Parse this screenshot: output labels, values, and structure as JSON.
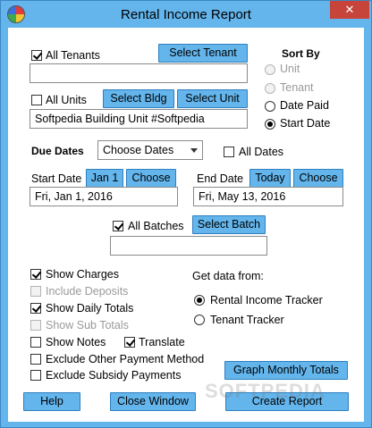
{
  "window": {
    "title": "Rental Income Report",
    "close_glyph": "✕"
  },
  "tenants": {
    "all_tenants_label": "All Tenants",
    "all_tenants_checked": true,
    "select_tenant_button": "Select Tenant",
    "tenant_value": ""
  },
  "units": {
    "all_units_label": "All Units",
    "all_units_checked": false,
    "select_bldg_button": "Select Bldg",
    "select_unit_button": "Select Unit",
    "unit_value": "Softpedia Building Unit #Softpedia"
  },
  "sort_by": {
    "heading": "Sort By",
    "options": [
      {
        "label": "Unit",
        "checked": false,
        "enabled": false
      },
      {
        "label": "Tenant",
        "checked": false,
        "enabled": false
      },
      {
        "label": "Date Paid",
        "checked": false,
        "enabled": true
      },
      {
        "label": "Start Date",
        "checked": true,
        "enabled": true
      }
    ]
  },
  "due_dates": {
    "heading": "Due Dates",
    "selected": "Choose Dates",
    "all_dates_label": "All Dates",
    "all_dates_checked": false
  },
  "start_date": {
    "label": "Start Date",
    "quick_button": "Jan 1",
    "choose_button": "Choose",
    "value": "Fri, Jan 1, 2016"
  },
  "end_date": {
    "label": "End Date",
    "quick_button": "Today",
    "choose_button": "Choose",
    "value": "Fri, May 13, 2016"
  },
  "batches": {
    "all_batches_label": "All Batches",
    "all_batches_checked": true,
    "select_batch_button": "Select Batch",
    "batch_value": ""
  },
  "options": [
    {
      "label": "Show Charges",
      "checked": true,
      "enabled": true
    },
    {
      "label": "Include Deposits",
      "checked": false,
      "enabled": false
    },
    {
      "label": "Show Daily Totals",
      "checked": true,
      "enabled": true
    },
    {
      "label": "Show Sub Totals",
      "checked": false,
      "enabled": false
    },
    {
      "label": "Show Notes",
      "checked": false,
      "enabled": true
    },
    {
      "label": "Translate",
      "checked": true,
      "enabled": true
    },
    {
      "label": "Exclude Other Payment Method",
      "checked": false,
      "enabled": true
    },
    {
      "label": "Exclude Subsidy Payments",
      "checked": false,
      "enabled": true
    }
  ],
  "data_source": {
    "heading": "Get data from:",
    "options": [
      {
        "label": "Rental Income Tracker",
        "checked": true
      },
      {
        "label": "Tenant Tracker",
        "checked": false
      }
    ]
  },
  "buttons": {
    "graph": "Graph Monthly Totals",
    "help": "Help",
    "close": "Close Window",
    "create": "Create Report"
  },
  "watermark": "SOFTPEDIA"
}
